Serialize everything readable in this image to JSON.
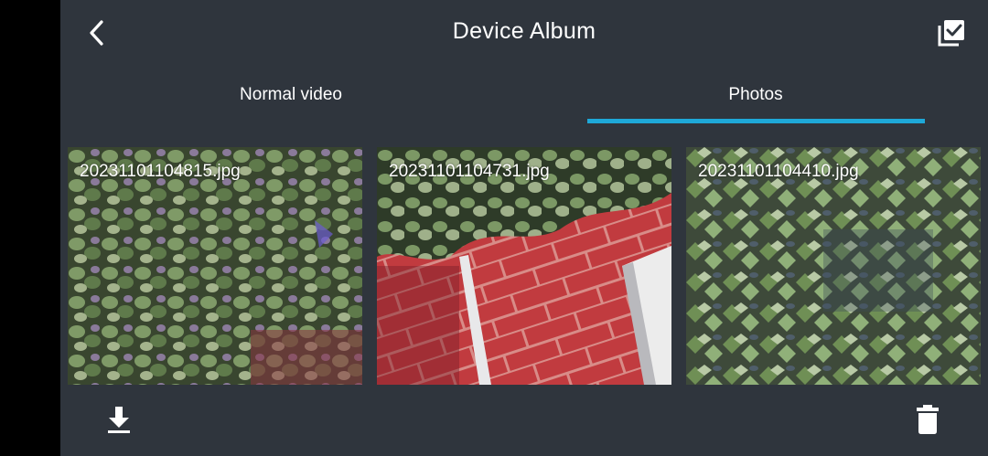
{
  "header": {
    "title": "Device Album",
    "back_icon": "chevron-left-icon",
    "select_icon": "select-all-icon"
  },
  "tabs": [
    {
      "label": "Normal video",
      "active": false
    },
    {
      "label": "Photos",
      "active": true
    }
  ],
  "accent_color": "#1ea8d8",
  "background_color": "#2f353d",
  "photos": [
    {
      "filename": "20231101104815.jpg",
      "subject": "ivy leaves"
    },
    {
      "filename": "20231101104731.jpg",
      "subject": "red brick wall with ivy"
    },
    {
      "filename": "20231101104410.jpg",
      "subject": "green ivy leaves"
    }
  ],
  "bottombar": {
    "download_icon": "download-icon",
    "delete_icon": "trash-icon"
  }
}
